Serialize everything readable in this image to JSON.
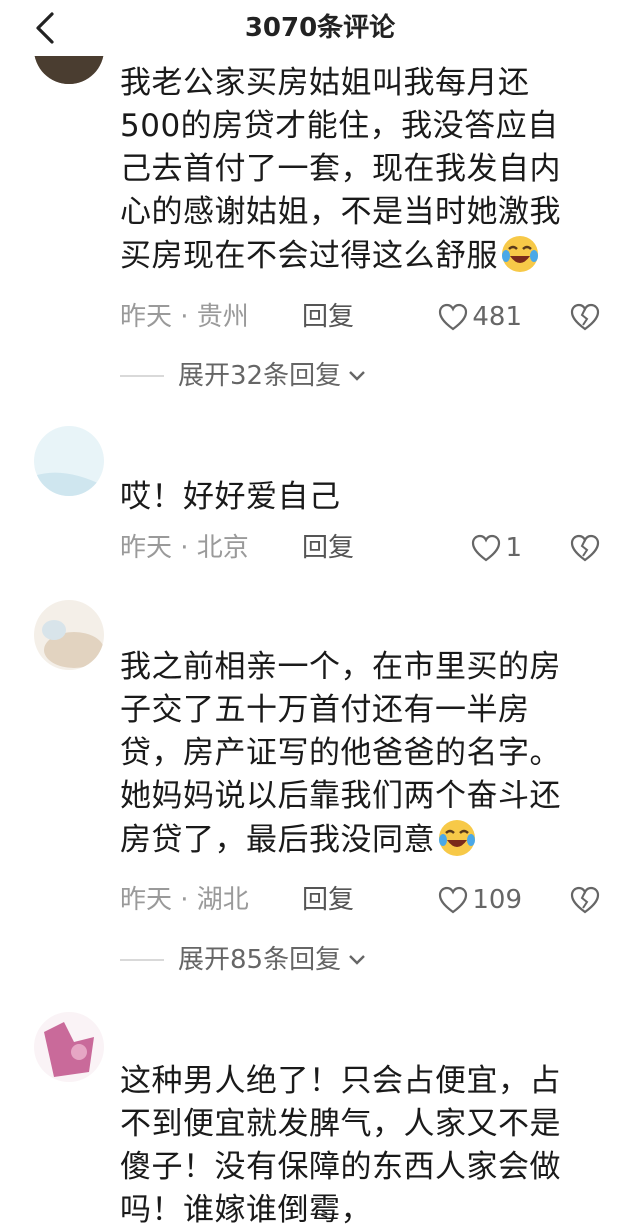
{
  "header": {
    "title": "3070条评论"
  },
  "comments": [
    {
      "username": "",
      "text": "我老公家买房姑姐叫我每月还\n500的房贷才能住，我没答应自\n己去首付了一套，现在我发自内\n心的感谢姑姐，不是当时她激我\n买房现在不会过得这么舒服",
      "emoji": "laughing-tears",
      "time_location": "昨天 · 贵州",
      "reply_label": "回复",
      "likes": "481",
      "expand_label": "展开32条回复"
    },
    {
      "username": "",
      "text": "哎！好好爱自己",
      "time_location": "昨天 · 北京",
      "reply_label": "回复",
      "likes": "1"
    },
    {
      "username": "",
      "text": "我之前相亲一个，在市里买的房\n子交了五十万首付还有一半房\n贷，房产证写的他爸爸的名字。\n她妈妈说以后靠我们两个奋斗还\n房贷了，最后我没同意",
      "emoji": "laughing-tears",
      "time_location": "昨天 · 湖北",
      "reply_label": "回复",
      "likes": "109",
      "expand_label": "展开85条回复"
    },
    {
      "username": "",
      "text": "这种男人绝了！只会占便宜，占\n不到便宜就发脾气，人家又不是\n傻子！没有保障的东西人家会做\n吗！谁嫁谁倒霉，"
    }
  ],
  "icons": {
    "back": "chevron-left-icon",
    "like": "heart-outline-icon",
    "dislike": "broken-heart-icon",
    "expand": "chevron-down-icon",
    "emoji": "laughing-tears-emoji"
  },
  "colors": {
    "text": "#1a1a1a",
    "meta": "#9a9a9a",
    "accent_emoji": "#f5c542"
  }
}
